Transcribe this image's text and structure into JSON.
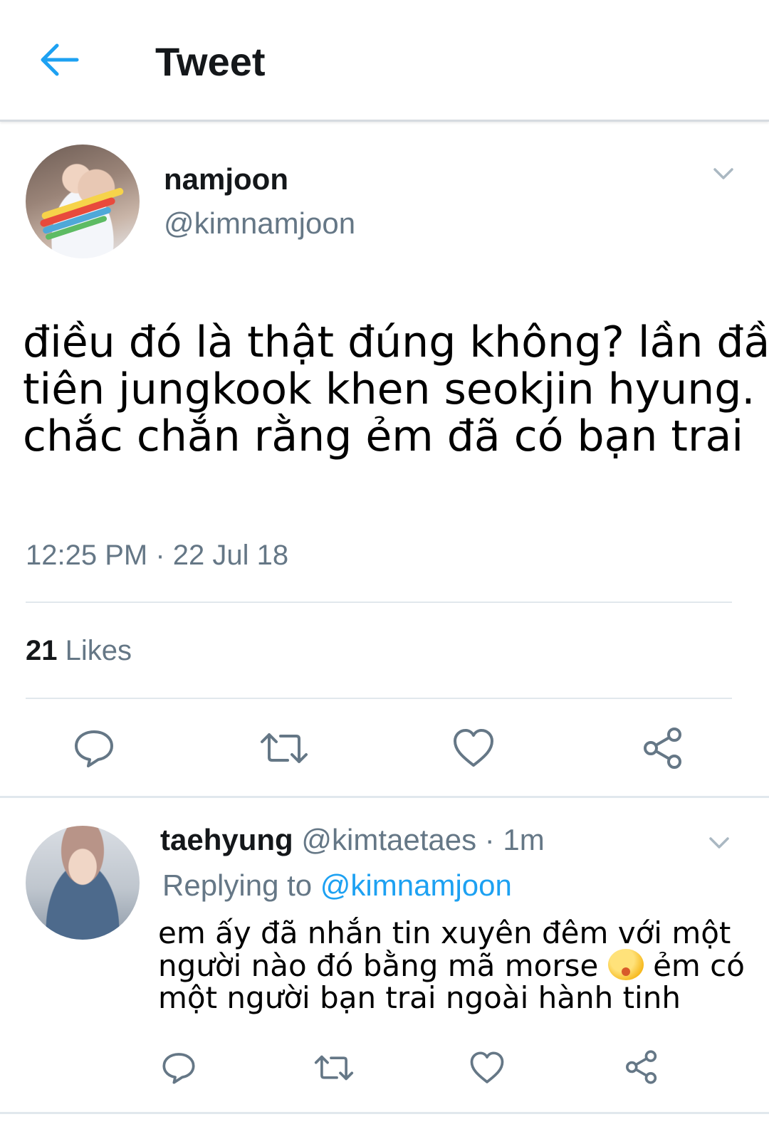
{
  "header": {
    "title": "Tweet"
  },
  "tweet": {
    "name": "namjoon",
    "handle": "@kimnamjoon",
    "text_lines": [
      "điều đó là thật đúng không? lần đầu",
      "tiên jungkook khen seokjin hyung.",
      "chắc chắn rằng ẻm đã có bạn trai"
    ],
    "timestamp": "12:25 PM · 22 Jul 18",
    "likes_count": "21",
    "likes_label": "Likes"
  },
  "reply": {
    "name": "taehyung",
    "meta": "@kimtaetaes · 1m",
    "replying_prefix": "Replying to",
    "replying_handle": "@kimnamjoon",
    "line1": "em ấy đã nhắn tin xuyên đêm với một",
    "line2_a": "người nào đó bằng mã morse",
    "line2_b": "ẻm có",
    "line3": "một người bạn trai ngoài hành tinh"
  },
  "colors": {
    "accent": "#1da1f2",
    "secondary_text": "#657786",
    "icon_gray": "#657786"
  },
  "icons": [
    "back-arrow-icon",
    "chevron-down-icon",
    "reply-icon",
    "retweet-icon",
    "like-icon",
    "share-icon",
    "sleepy-face-emoji"
  ]
}
